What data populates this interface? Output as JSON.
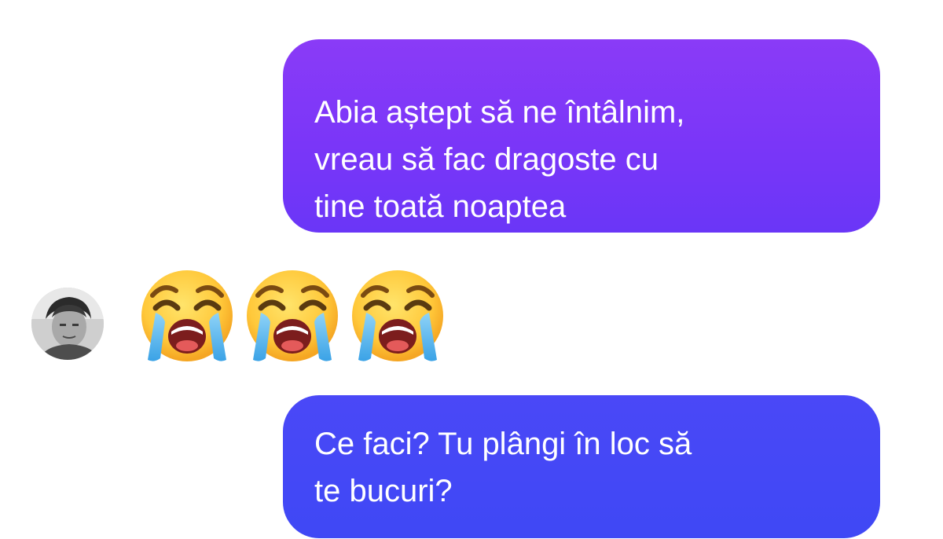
{
  "messages": [
    {
      "direction": "outgoing",
      "text": "Abia aștept să ne întâlnim,\nvreau să fac dragoste cu\ntine toată noaptea",
      "color": "#7a36f8"
    },
    {
      "direction": "incoming",
      "emojis": [
        "loudly-crying-face-icon",
        "loudly-crying-face-icon",
        "loudly-crying-face-icon"
      ]
    },
    {
      "direction": "outgoing",
      "text": "Ce faci? Tu plângi în loc să\nte bucuri?",
      "color": "#4348f6"
    }
  ],
  "contact": {
    "avatar_icon": "contact-avatar"
  },
  "theme": {
    "background": "#ffffff",
    "emoji_face": "#ffcc3a",
    "tear_color": "#5fbbef"
  }
}
